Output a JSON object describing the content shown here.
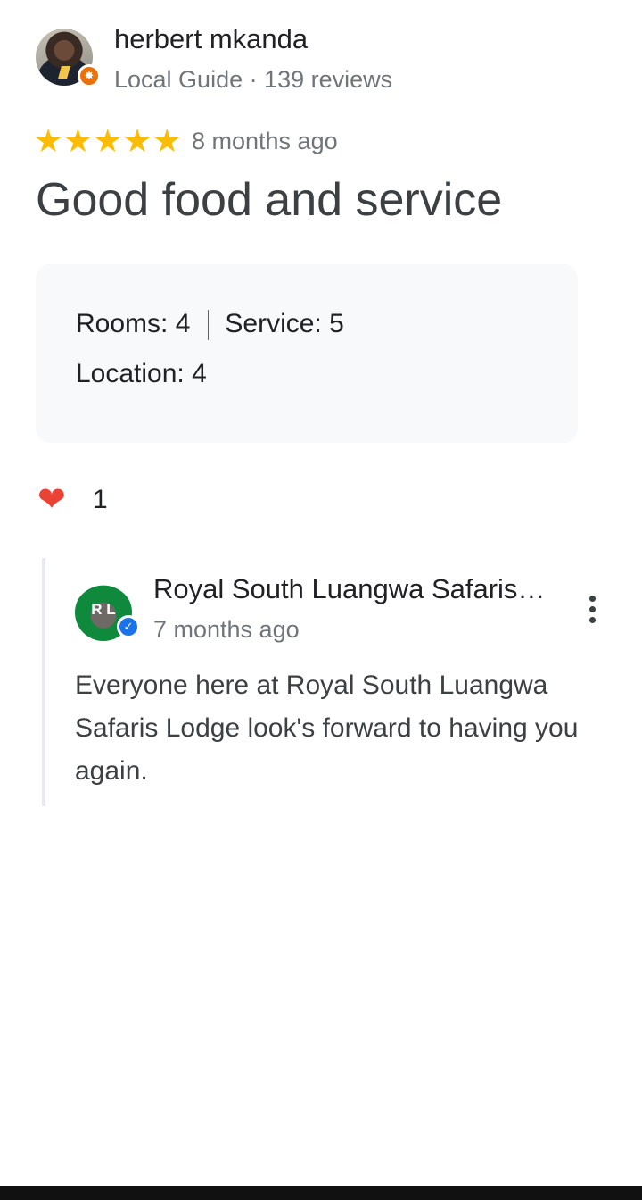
{
  "author": {
    "name": "herbert mkanda",
    "meta": "Local Guide · 139 reviews",
    "badge_icon": "local-guide-star"
  },
  "review": {
    "rating": 5,
    "stars": [
      "★",
      "★",
      "★",
      "★",
      "★"
    ],
    "time": "8 months ago",
    "title": "Good food and service",
    "ratings": {
      "rooms_label": "Rooms:",
      "rooms_value": "4",
      "service_label": "Service:",
      "service_value": "5",
      "location_label": "Location:",
      "location_value": "4"
    },
    "reaction": {
      "icon": "heart",
      "count": "1"
    }
  },
  "owner_response": {
    "name": "Royal South Luangwa Safaris Lodge",
    "avatar_text": "R L",
    "time": "7 months ago",
    "text": "Everyone here at Royal South Luangwa Safaris Lodge look's forward to having you again."
  },
  "colors": {
    "star": "#fbbc04",
    "heart": "#ea4335",
    "verified": "#1a73e8",
    "guide_badge": "#e8710a"
  }
}
